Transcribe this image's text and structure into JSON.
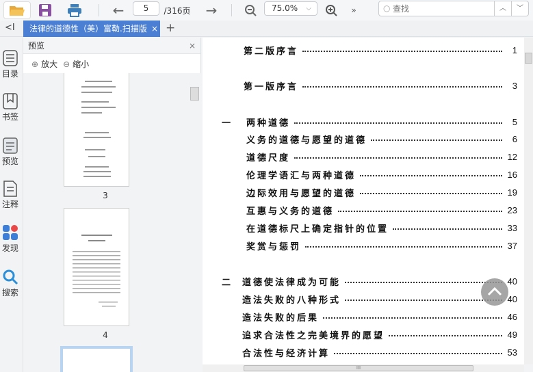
{
  "toolbar": {
    "page_current": "5",
    "page_total": "/316页",
    "zoom": "75.0%",
    "search_placeholder": "查找"
  },
  "tab": {
    "title": "法律的道德性（美）富勒.扫描版",
    "close": "×",
    "add": "+",
    "collapse": "<I"
  },
  "nav": [
    {
      "label": "目录",
      "icon": "list-icon"
    },
    {
      "label": "书签",
      "icon": "bookmark-icon"
    },
    {
      "label": "预览",
      "icon": "preview-icon"
    },
    {
      "label": "注释",
      "icon": "annotation-icon"
    },
    {
      "label": "发现",
      "icon": "discover-icon"
    },
    {
      "label": "搜索",
      "icon": "search-icon"
    }
  ],
  "preview": {
    "title": "预览",
    "close": "×",
    "zoom_in": "放大",
    "zoom_out": "缩小",
    "pages": [
      "3",
      "4"
    ]
  },
  "toc": [
    {
      "num": "",
      "title": "第二版序言",
      "page": "1"
    },
    {
      "num": "",
      "title": "第一版序言",
      "page": "3"
    },
    {
      "num": "一",
      "title": "两种道德",
      "page": "5"
    },
    {
      "num": "",
      "title": "义务的道德与愿望的道德",
      "page": "6"
    },
    {
      "num": "",
      "title": "道德尺度",
      "page": "12"
    },
    {
      "num": "",
      "title": "伦理学语汇与两种道德",
      "page": "16"
    },
    {
      "num": "",
      "title": "边际效用与愿望的道德",
      "page": "19"
    },
    {
      "num": "",
      "title": "互惠与义务的道德",
      "page": "23"
    },
    {
      "num": "",
      "title": "在道德标尺上确定指针的位置",
      "page": "33"
    },
    {
      "num": "",
      "title": "奖赏与惩罚",
      "page": "37"
    },
    {
      "num": "二",
      "title": "道德使法律成为可能",
      "page": "40"
    },
    {
      "num": "",
      "title": "造法失败的八种形式",
      "page": "40"
    },
    {
      "num": "",
      "title": "造法失败的后果",
      "page": "46"
    },
    {
      "num": "",
      "title": "追求合法性之完美境界的愿望",
      "page": "49"
    },
    {
      "num": "",
      "title": "合法性与经济计算",
      "page": "53"
    }
  ]
}
